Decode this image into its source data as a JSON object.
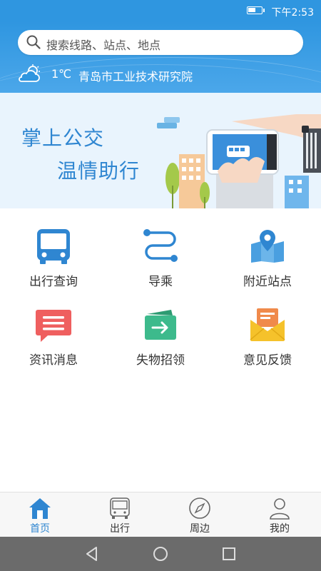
{
  "status": {
    "time": "下午2:53",
    "battery_level": 0.6
  },
  "search": {
    "placeholder": "搜索线路、站点、地点",
    "icon": "search-icon"
  },
  "weather": {
    "icon": "partly-cloudy-icon",
    "temperature": "1℃",
    "location": "青岛市工业技术研究院"
  },
  "banner": {
    "line1": "掌上公交",
    "line2": "温情助行"
  },
  "menu": [
    {
      "label": "出行查询",
      "icon": "bus-icon",
      "color": "#2f86d1"
    },
    {
      "label": "导乘",
      "icon": "route-icon",
      "color": "#2f86d1"
    },
    {
      "label": "附近站点",
      "icon": "map-pin-icon",
      "color": "#4a9fe0"
    },
    {
      "label": "资讯消息",
      "icon": "message-icon",
      "color": "#ef5f5f"
    },
    {
      "label": "失物招领",
      "icon": "wallet-icon",
      "color": "#3dba8c"
    },
    {
      "label": "意见反馈",
      "icon": "envelope-icon",
      "color": "#f5c22b"
    }
  ],
  "tabs": [
    {
      "label": "首页",
      "icon": "home-icon",
      "active": true
    },
    {
      "label": "出行",
      "icon": "bus-outline-icon",
      "active": false
    },
    {
      "label": "周边",
      "icon": "compass-icon",
      "active": false
    },
    {
      "label": "我的",
      "icon": "user-icon",
      "active": false
    }
  ],
  "colors": {
    "primary": "#2f96e0",
    "accent": "#2f86d1",
    "banner_bg": "#e9f4fd",
    "navbar": "#6b6b6b"
  }
}
